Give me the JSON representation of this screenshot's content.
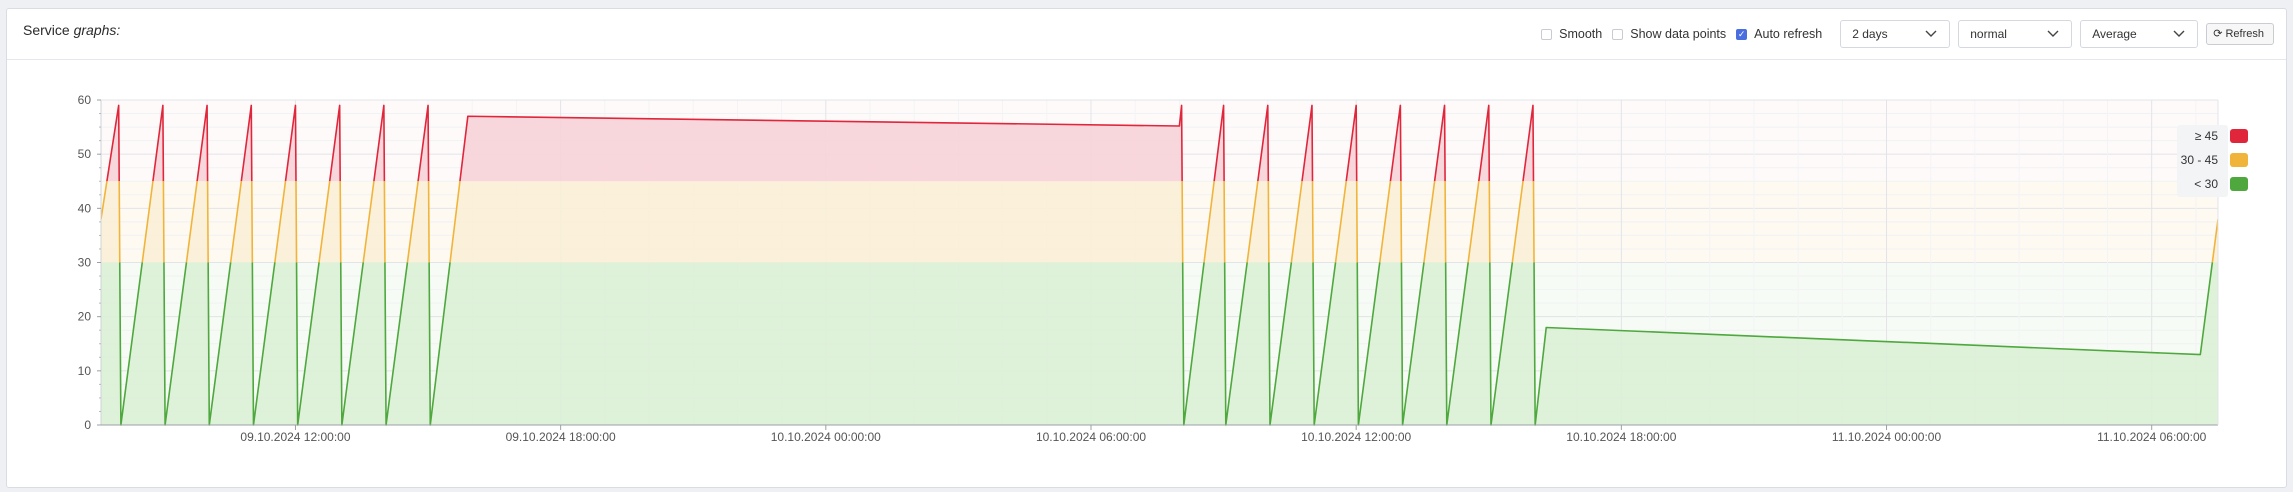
{
  "header": {
    "title_main": "Service",
    "title_em": "graphs:",
    "smooth_label": "Smooth",
    "smooth_checked": false,
    "datapoints_label": "Show data points",
    "datapoints_checked": false,
    "autorefresh_label": "Auto refresh",
    "autorefresh_checked": true,
    "range_value": "2 days",
    "mode_value": "normal",
    "agg_value": "Average",
    "refresh_label": "Refresh",
    "refresh_icon": "refresh-icon"
  },
  "colors": {
    "red": "#e0263b",
    "yellow": "#f0b43a",
    "green": "#4ea83e",
    "red_fill": "#f7d3d8",
    "yellow_fill": "#fbefd7",
    "green_fill": "#dcefd6"
  },
  "chart_data": {
    "type": "area",
    "ylim": [
      0,
      60
    ],
    "yticks": [
      0,
      10,
      20,
      30,
      40,
      50,
      60
    ],
    "thresholds": [
      30,
      45
    ],
    "x_tick_labels": [
      "09.10.2024 12:00:00",
      "09.10.2024 18:00:00",
      "10.10.2024 00:00:00",
      "10.10.2024 06:00:00",
      "10.10.2024 12:00:00",
      "10.10.2024 18:00:00",
      "11.10.2024 00:00:00",
      "11.10.2024 06:00:00"
    ],
    "x_range_hours": [
      -4.4,
      43.5
    ],
    "legend": [
      {
        "label": "≥ 45",
        "color": "#e0263b"
      },
      {
        "label": "30 - 45",
        "color": "#f0b43a"
      },
      {
        "label": "< 30",
        "color": "#4ea83e"
      }
    ],
    "points": [
      [
        -4.4,
        38
      ],
      [
        -4.0,
        59
      ],
      [
        -3.95,
        0
      ],
      [
        -3.0,
        59
      ],
      [
        -2.95,
        0
      ],
      [
        -2.0,
        59
      ],
      [
        -1.95,
        0
      ],
      [
        -1.0,
        59
      ],
      [
        -0.95,
        0
      ],
      [
        0.0,
        59
      ],
      [
        0.05,
        0
      ],
      [
        1.0,
        59
      ],
      [
        1.05,
        0
      ],
      [
        2.0,
        59
      ],
      [
        2.05,
        0
      ],
      [
        3.0,
        59
      ],
      [
        3.05,
        0
      ],
      [
        3.9,
        57
      ],
      [
        20.0,
        55.2
      ],
      [
        20.05,
        59
      ],
      [
        20.1,
        0
      ],
      [
        21.0,
        59
      ],
      [
        21.05,
        0
      ],
      [
        22.0,
        59
      ],
      [
        22.05,
        0
      ],
      [
        23.0,
        59
      ],
      [
        23.05,
        0
      ],
      [
        24.0,
        59
      ],
      [
        24.05,
        0
      ],
      [
        25.0,
        59
      ],
      [
        25.05,
        0
      ],
      [
        26.0,
        59
      ],
      [
        26.05,
        0
      ],
      [
        27.0,
        59
      ],
      [
        27.05,
        0
      ],
      [
        28.0,
        59
      ],
      [
        28.05,
        0
      ],
      [
        28.3,
        18
      ],
      [
        43.1,
        13
      ],
      [
        43.5,
        38
      ]
    ]
  }
}
